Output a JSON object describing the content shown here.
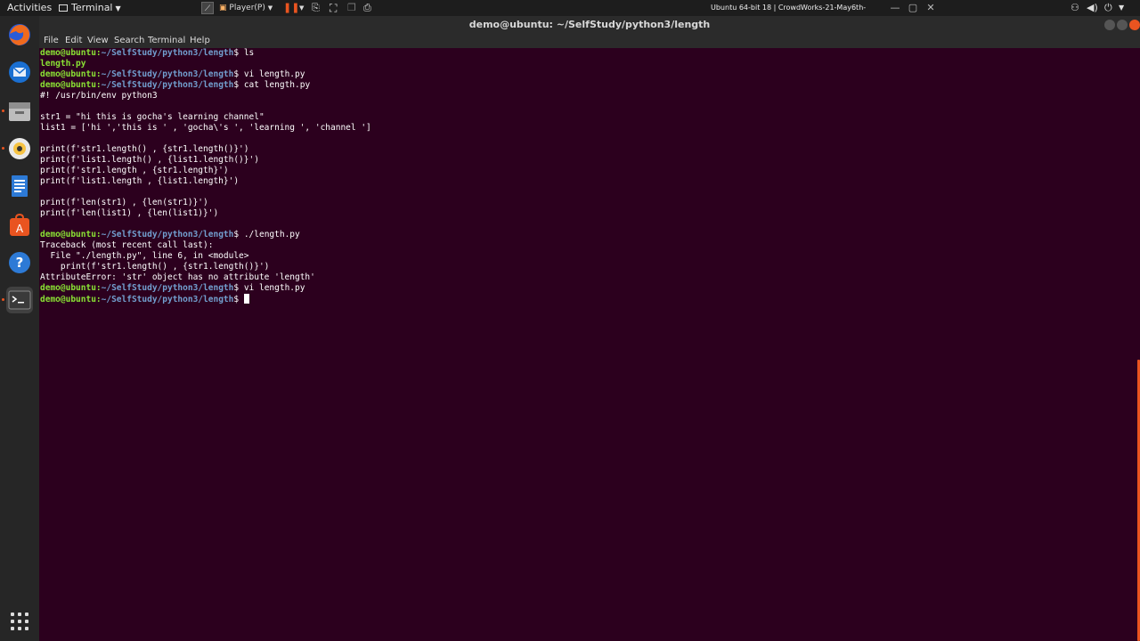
{
  "topbar": {
    "activities": "Activities",
    "app_name": "Terminal",
    "vm_menu": "Player(P)",
    "vm_title": "Ubuntu 64-bit 18 | CrowdWorks-21-May6th-1148"
  },
  "window": {
    "title": "demo@ubuntu: ~/SelfStudy/python3/length"
  },
  "menubar": [
    "File",
    "Edit",
    "View",
    "Search",
    "Terminal",
    "Help"
  ],
  "dock": [
    "firefox-icon",
    "thunderbird-icon",
    "files-icon",
    "rhythmbox-icon",
    "writer-icon",
    "software-icon",
    "help-icon",
    "terminal-icon"
  ],
  "colors": {
    "terminal_bg": "#2c001e",
    "prompt_user": "#8ae234",
    "prompt_path": "#729fcf",
    "accent": "#e95420"
  },
  "terminal": {
    "prompt_user": "demo@ubuntu:",
    "prompt_path": "~/SelfStudy/python3/length",
    "prompt_symbol": "$ ",
    "lines": [
      {
        "prompt": true,
        "cmd": "ls"
      },
      {
        "text": "length.py",
        "green": true
      },
      {
        "prompt": true,
        "cmd": "vi length.py"
      },
      {
        "prompt": true,
        "cmd": "cat length.py"
      },
      {
        "text": "#! /usr/bin/env python3"
      },
      {
        "text": ""
      },
      {
        "text": "str1 = \"hi this is gocha's learning channel\""
      },
      {
        "text": "list1 = ['hi ','this is ' , 'gocha\\'s ', 'learning ', 'channel ']"
      },
      {
        "text": ""
      },
      {
        "text": "print(f'str1.length() , {str1.length()}')"
      },
      {
        "text": "print(f'list1.length() , {list1.length()}')"
      },
      {
        "text": "print(f'str1.length , {str1.length}')"
      },
      {
        "text": "print(f'list1.length , {list1.length}')"
      },
      {
        "text": ""
      },
      {
        "text": "print(f'len(str1) , {len(str1)}')"
      },
      {
        "text": "print(f'len(list1) , {len(list1)}')"
      },
      {
        "text": ""
      },
      {
        "prompt": true,
        "cmd": "./length.py"
      },
      {
        "text": "Traceback (most recent call last):"
      },
      {
        "text": "  File \"./length.py\", line 6, in <module>"
      },
      {
        "text": "    print(f'str1.length() , {str1.length()}')"
      },
      {
        "text": "AttributeError: 'str' object has no attribute 'length'"
      },
      {
        "prompt": true,
        "cmd": "vi length.py"
      },
      {
        "prompt": true,
        "cmd": "",
        "cursor": true
      }
    ]
  }
}
